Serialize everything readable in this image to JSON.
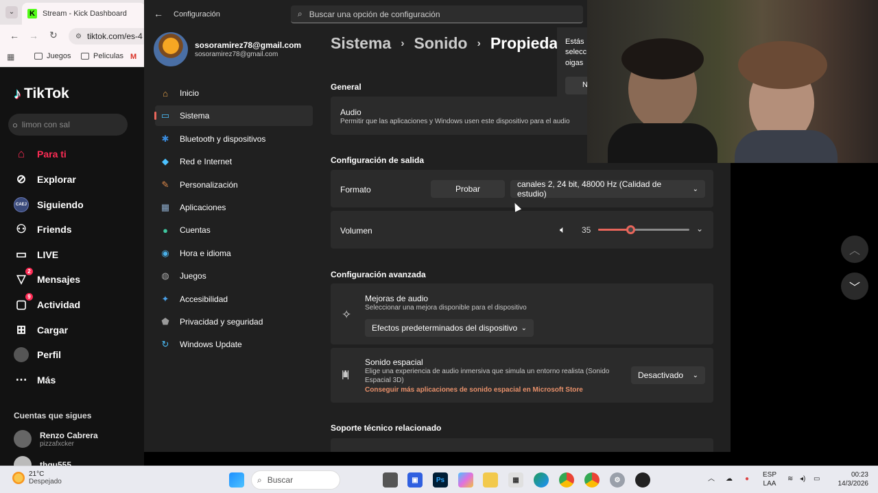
{
  "browser": {
    "tab_title": "Stream - Kick Dashboard",
    "url": "tiktok.com/es-4",
    "bookmarks": [
      "Juegos",
      "Peliculas"
    ]
  },
  "tiktok": {
    "logo": "TikTok",
    "search_placeholder": "limon con sal",
    "nav": [
      {
        "label": "Para ti",
        "icon": "home-icon"
      },
      {
        "label": "Explorar",
        "icon": "compass-icon"
      },
      {
        "label": "Siguiendo",
        "icon": "following-avatar-icon"
      },
      {
        "label": "Friends",
        "icon": "friends-icon"
      },
      {
        "label": "LIVE",
        "icon": "live-icon"
      },
      {
        "label": "Mensajes",
        "icon": "messages-icon",
        "badge": "2"
      },
      {
        "label": "Actividad",
        "icon": "activity-icon",
        "badge": "9"
      },
      {
        "label": "Cargar",
        "icon": "upload-icon"
      },
      {
        "label": "Perfil",
        "icon": "profile-icon"
      },
      {
        "label": "Más",
        "icon": "more-icon"
      }
    ],
    "following_title": "Cuentas que sigues",
    "accounts": [
      {
        "name": "Renzo Cabrera",
        "handle": "pizzafxcker"
      },
      {
        "name": "thgu555",
        "handle": ""
      }
    ]
  },
  "settings": {
    "app_title": "Configuración",
    "search_placeholder": "Buscar una opción de configuración",
    "user_email": "sosoramirez78@gmail.com",
    "user_email_sub": "sosoramirez78@gmail.com",
    "nav": [
      {
        "label": "Inicio",
        "icon": "home-icon",
        "color": "#e8a44a"
      },
      {
        "label": "Sistema",
        "icon": "system-icon",
        "color": "#4cc2ff",
        "selected": true
      },
      {
        "label": "Bluetooth y dispositivos",
        "icon": "bluetooth-icon",
        "color": "#3a8de0"
      },
      {
        "label": "Red e Internet",
        "icon": "wifi-icon",
        "color": "#4cc2ff"
      },
      {
        "label": "Personalización",
        "icon": "brush-icon",
        "color": "#e08a4a"
      },
      {
        "label": "Aplicaciones",
        "icon": "apps-icon",
        "color": "#8aa8c8"
      },
      {
        "label": "Cuentas",
        "icon": "account-icon",
        "color": "#3fc8a0"
      },
      {
        "label": "Hora e idioma",
        "icon": "globe-clock-icon",
        "color": "#4ab0e8"
      },
      {
        "label": "Juegos",
        "icon": "gamepad-icon",
        "color": "#aaaaaa"
      },
      {
        "label": "Accesibilidad",
        "icon": "accessibility-icon",
        "color": "#4aa0e8"
      },
      {
        "label": "Privacidad y seguridad",
        "icon": "shield-icon",
        "color": "#9a9a9a"
      },
      {
        "label": "Windows Update",
        "icon": "update-icon",
        "color": "#4cc2ff"
      }
    ],
    "breadcrumb": [
      "Sistema",
      "Sonido",
      "Propiedades"
    ],
    "general_heading": "General",
    "audio_title": "Audio",
    "audio_desc": "Permitir que las aplicaciones y Windows usen este dispositivo para el audio",
    "output_heading": "Configuración de salida",
    "format_label": "Formato",
    "test_button": "Probar",
    "format_value": "canales 2, 24 bit, 48000 Hz (Calidad de estudio)",
    "volume_label": "Volumen",
    "volume_value": "35",
    "volume_level": 0.35,
    "advanced_heading": "Configuración avanzada",
    "enhance_title": "Mejoras de audio",
    "enhance_desc": "Seleccionar una mejora disponible para el dispositivo",
    "enhance_value": "Efectos predeterminados del dispositivo",
    "spatial_title": "Sonido espacial",
    "spatial_desc1": "Elige una experiencia de audio inmersiva que simula un entorno realista (Sonido",
    "spatial_desc2": "Espacial 3D)",
    "spatial_link": "Conseguir más aplicaciones de sonido espacial en Microsoft Store",
    "spatial_value": "Desactivado",
    "support_heading": "Soporte técnico relacionado",
    "accent": "#e9665b"
  },
  "popup": {
    "line1": "Estás",
    "line2": "selecc",
    "line3": "oigas",
    "btn": "N"
  },
  "taskbar": {
    "temperature": "21°C",
    "weather": "Despejado",
    "search_label": "Buscar",
    "lang1": "ESP",
    "lang2": "LAA",
    "time": "00:23",
    "date": "14/3/2026"
  }
}
